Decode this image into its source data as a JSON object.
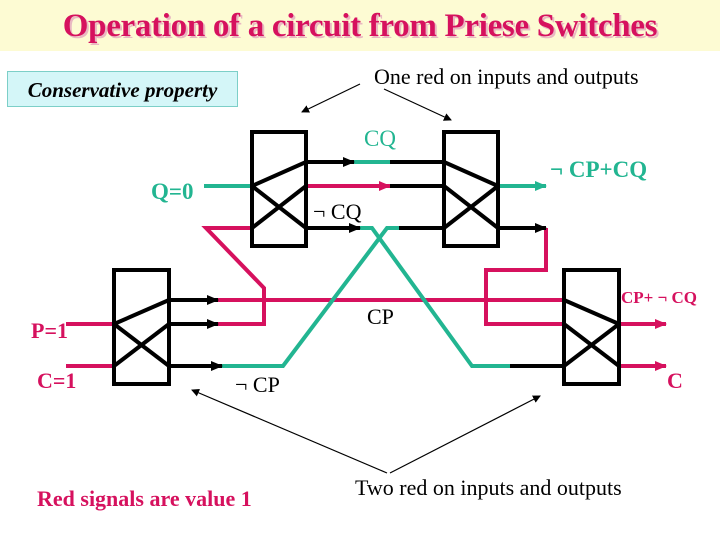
{
  "title": "Operation of a circuit from Priese Switches",
  "property_box": {
    "label": "Conservative property"
  },
  "annotations": {
    "one_red": "One red on inputs and outputs",
    "two_red": "Two red on inputs and outputs",
    "legend": "Red signals are value 1"
  },
  "signals": {
    "q_input": "Q=0",
    "p_input": "P=1",
    "c_input": "C=1",
    "cq": "CQ",
    "not_cq": "¬ CQ",
    "cp": "CP",
    "not_cp": "¬ CP",
    "out_not_cp_plus_cq": "¬ CP+CQ",
    "out_cp_plus_not_cq": "CP+ ¬ CQ",
    "out_c": "C"
  },
  "colors": {
    "red_signal": "#d6115e",
    "teal_signal": "#22b591",
    "wire_black": "#000000",
    "title_bg": "#fdfbd3",
    "property_bg": "#d4f6f8"
  },
  "switches": [
    {
      "id": "switch-top-left"
    },
    {
      "id": "switch-top-right"
    },
    {
      "id": "switch-bottom-left"
    },
    {
      "id": "switch-bottom-right"
    }
  ]
}
